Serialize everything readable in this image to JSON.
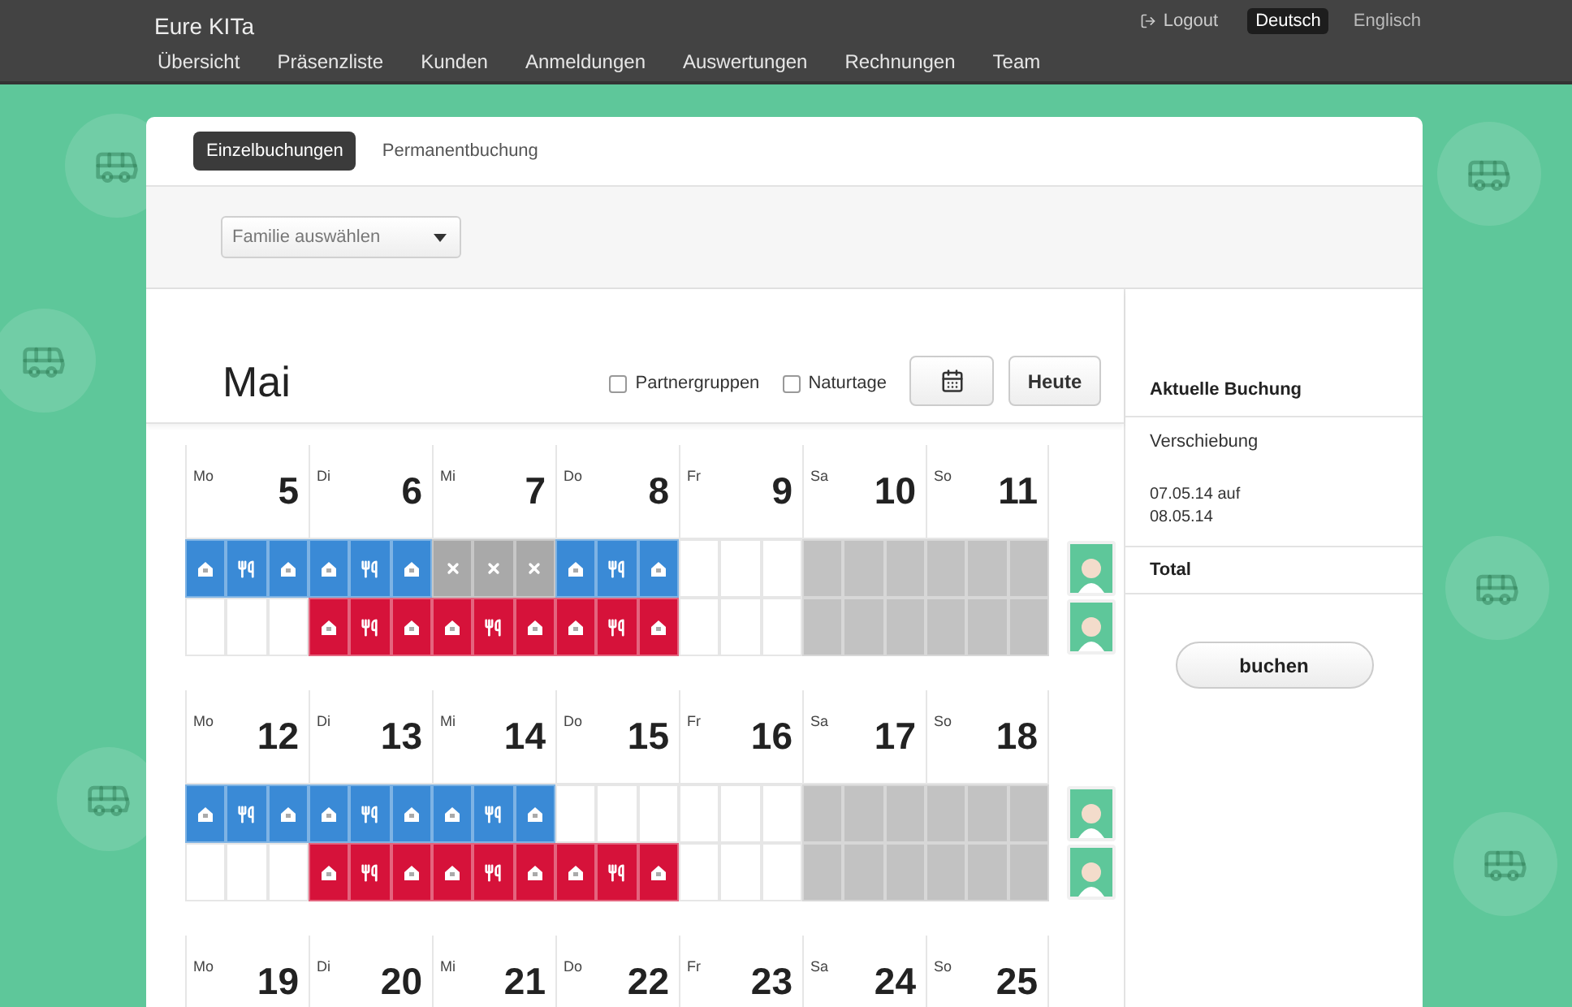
{
  "header": {
    "brand": "Eure KITa",
    "nav": [
      "Übersicht",
      "Präsenzliste",
      "Kunden",
      "Anmeldungen",
      "Auswertungen",
      "Rechnungen",
      "Team"
    ],
    "logout": "Logout",
    "languages": [
      {
        "label": "Deutsch",
        "selected": true
      },
      {
        "label": "Englisch",
        "selected": false
      }
    ]
  },
  "tabs": [
    {
      "label": "Einzelbuchungen",
      "selected": true
    },
    {
      "label": "Permanentbuchung",
      "selected": false
    }
  ],
  "family_select": {
    "value": "Familie auswählen"
  },
  "calendar": {
    "month": "Mai",
    "filters": [
      {
        "label": "Partnergruppen",
        "checked": false
      },
      {
        "label": "Naturtage",
        "checked": false
      }
    ],
    "today_button": "Heute",
    "weeks": [
      {
        "days": [
          {
            "abbr": "Mo",
            "number": "5"
          },
          {
            "abbr": "Di",
            "number": "6"
          },
          {
            "abbr": "Mi",
            "number": "7"
          },
          {
            "abbr": "Do",
            "number": "8"
          },
          {
            "abbr": "Fr",
            "number": "9"
          },
          {
            "abbr": "Sa",
            "number": "10"
          },
          {
            "abbr": "So",
            "number": "11"
          }
        ],
        "rows": [
          {
            "color": "#3a8ad6",
            "slots": [
              {
                "kind": "house"
              },
              {
                "kind": "meal"
              },
              {
                "kind": "house"
              },
              {
                "kind": "house"
              },
              {
                "kind": "meal"
              },
              {
                "kind": "house"
              },
              {
                "kind": "cancelled"
              },
              {
                "kind": "cancelled"
              },
              {
                "kind": "cancelled"
              },
              {
                "kind": "house"
              },
              {
                "kind": "meal"
              },
              {
                "kind": "house"
              },
              {
                "kind": "empty"
              },
              {
                "kind": "empty"
              },
              {
                "kind": "empty"
              },
              {
                "kind": "closed"
              },
              {
                "kind": "closed"
              },
              {
                "kind": "closed"
              },
              {
                "kind": "closed"
              },
              {
                "kind": "closed"
              },
              {
                "kind": "closed"
              }
            ]
          },
          {
            "color": "#d6123a",
            "slots": [
              {
                "kind": "empty"
              },
              {
                "kind": "empty"
              },
              {
                "kind": "empty"
              },
              {
                "kind": "house"
              },
              {
                "kind": "meal"
              },
              {
                "kind": "house"
              },
              {
                "kind": "house"
              },
              {
                "kind": "meal"
              },
              {
                "kind": "house"
              },
              {
                "kind": "house"
              },
              {
                "kind": "meal"
              },
              {
                "kind": "house"
              },
              {
                "kind": "empty"
              },
              {
                "kind": "empty"
              },
              {
                "kind": "empty"
              },
              {
                "kind": "closed"
              },
              {
                "kind": "closed"
              },
              {
                "kind": "closed"
              },
              {
                "kind": "closed"
              },
              {
                "kind": "closed"
              },
              {
                "kind": "closed"
              }
            ]
          }
        ]
      },
      {
        "days": [
          {
            "abbr": "Mo",
            "number": "12"
          },
          {
            "abbr": "Di",
            "number": "13"
          },
          {
            "abbr": "Mi",
            "number": "14"
          },
          {
            "abbr": "Do",
            "number": "15"
          },
          {
            "abbr": "Fr",
            "number": "16"
          },
          {
            "abbr": "Sa",
            "number": "17"
          },
          {
            "abbr": "So",
            "number": "18"
          }
        ],
        "rows": [
          {
            "color": "#3a8ad6",
            "slots": [
              {
                "kind": "house"
              },
              {
                "kind": "meal"
              },
              {
                "kind": "house"
              },
              {
                "kind": "house"
              },
              {
                "kind": "meal"
              },
              {
                "kind": "house"
              },
              {
                "kind": "house"
              },
              {
                "kind": "meal"
              },
              {
                "kind": "house"
              },
              {
                "kind": "empty"
              },
              {
                "kind": "empty"
              },
              {
                "kind": "empty"
              },
              {
                "kind": "empty"
              },
              {
                "kind": "empty"
              },
              {
                "kind": "empty"
              },
              {
                "kind": "closed"
              },
              {
                "kind": "closed"
              },
              {
                "kind": "closed"
              },
              {
                "kind": "closed"
              },
              {
                "kind": "closed"
              },
              {
                "kind": "closed"
              }
            ]
          },
          {
            "color": "#d6123a",
            "slots": [
              {
                "kind": "empty"
              },
              {
                "kind": "empty"
              },
              {
                "kind": "empty"
              },
              {
                "kind": "house"
              },
              {
                "kind": "meal"
              },
              {
                "kind": "house"
              },
              {
                "kind": "house"
              },
              {
                "kind": "meal"
              },
              {
                "kind": "house"
              },
              {
                "kind": "house"
              },
              {
                "kind": "meal"
              },
              {
                "kind": "house"
              },
              {
                "kind": "empty"
              },
              {
                "kind": "empty"
              },
              {
                "kind": "empty"
              },
              {
                "kind": "closed"
              },
              {
                "kind": "closed"
              },
              {
                "kind": "closed"
              },
              {
                "kind": "closed"
              },
              {
                "kind": "closed"
              },
              {
                "kind": "closed"
              }
            ]
          }
        ]
      },
      {
        "days": [
          {
            "abbr": "Mo",
            "number": "19"
          },
          {
            "abbr": "Di",
            "number": "20"
          },
          {
            "abbr": "Mi",
            "number": "21"
          },
          {
            "abbr": "Do",
            "number": "22"
          },
          {
            "abbr": "Fr",
            "number": "23"
          },
          {
            "abbr": "Sa",
            "number": "24"
          },
          {
            "abbr": "So",
            "number": "25"
          }
        ]
      }
    ]
  },
  "sidebar": {
    "heading": "Aktuelle Buchung",
    "type": "Verschiebung",
    "details": [
      "07.05.14 auf",
      "08.05.14"
    ],
    "total": "Total",
    "book_button": "buchen"
  }
}
